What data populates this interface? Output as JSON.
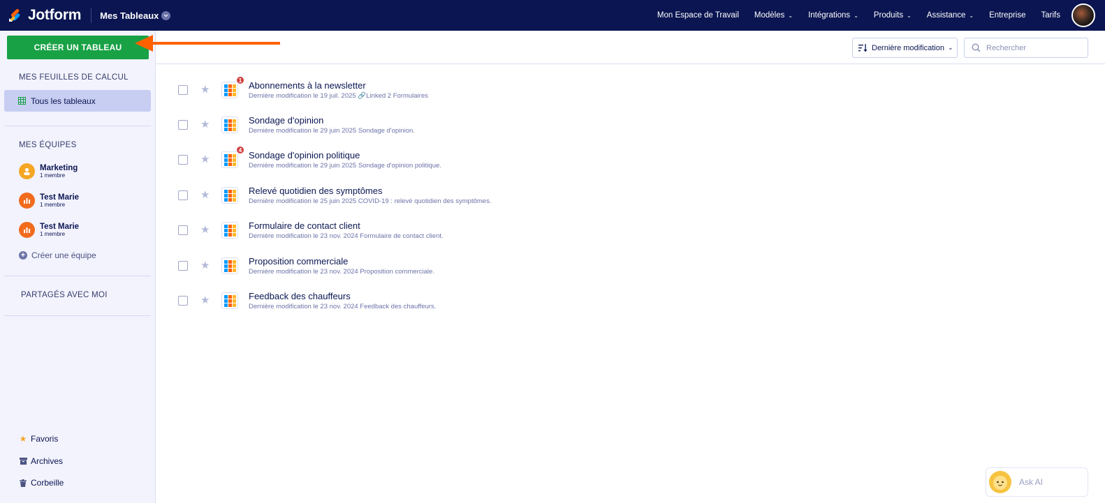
{
  "topbar": {
    "brand": "Jotform",
    "workspace_title": "Mes Tableaux",
    "nav": [
      {
        "label": "Mon Espace de Travail",
        "dropdown": false
      },
      {
        "label": "Modèles",
        "dropdown": true
      },
      {
        "label": "Intégrations",
        "dropdown": true
      },
      {
        "label": "Produits",
        "dropdown": true
      },
      {
        "label": "Assistance",
        "dropdown": true
      },
      {
        "label": "Entreprise",
        "dropdown": false
      },
      {
        "label": "Tarifs",
        "dropdown": false
      }
    ]
  },
  "sidebar": {
    "create_button": "CRÉER UN TABLEAU",
    "section_sheets": "MES FEUILLES DE CALCUL",
    "all_tables": "Tous les tableaux",
    "section_teams": "MES ÉQUIPES",
    "teams": [
      {
        "name": "Marketing",
        "members": "1 membre"
      },
      {
        "name": "Test Marie",
        "members": "1 membre"
      },
      {
        "name": "Test Marie",
        "members": "1 membre"
      }
    ],
    "create_team": "Créer une équipe",
    "section_shared": "PARTAGÉS AVEC MOI",
    "favorites": "Favoris",
    "archives": "Archives",
    "trash": "Corbeille"
  },
  "toolbar": {
    "sort_label": "Dernière modification",
    "search_placeholder": "Rechercher"
  },
  "tables": [
    {
      "title": "Abonnements à la newsletter",
      "meta": "Dernière modification le 19 juil. 2025",
      "linked": "Linked 2 Formulaires",
      "badge": "1"
    },
    {
      "title": "Sondage d'opinion",
      "meta": "Dernière modification le 29 juin 2025 Sondage d'opinion.",
      "linked": "",
      "badge": ""
    },
    {
      "title": "Sondage d'opinion politique",
      "meta": "Dernière modification le 29 juin 2025 Sondage d'opinion politique.",
      "linked": "",
      "badge": "4"
    },
    {
      "title": "Relevé quotidien des symptômes",
      "meta": "Dernière modification le 25 juin 2025 COVID-19 : relevé quotidien des symptômes.",
      "linked": "",
      "badge": ""
    },
    {
      "title": "Formulaire de contact client",
      "meta": "Dernière modification le 23 nov. 2024 Formulaire de contact client.",
      "linked": "",
      "badge": ""
    },
    {
      "title": "Proposition commerciale",
      "meta": "Dernière modification le 23 nov. 2024 Proposition commerciale.",
      "linked": "",
      "badge": ""
    },
    {
      "title": "Feedback des chauffeurs",
      "meta": "Dernière modification le 23 nov. 2024 Feedback des chauffeurs.",
      "linked": "",
      "badge": ""
    }
  ],
  "ask_ai": "Ask AI",
  "colors": {
    "navy": "#0a1551",
    "green": "#18a245",
    "arrow": "#ff6100",
    "badge": "#d13f3f"
  }
}
